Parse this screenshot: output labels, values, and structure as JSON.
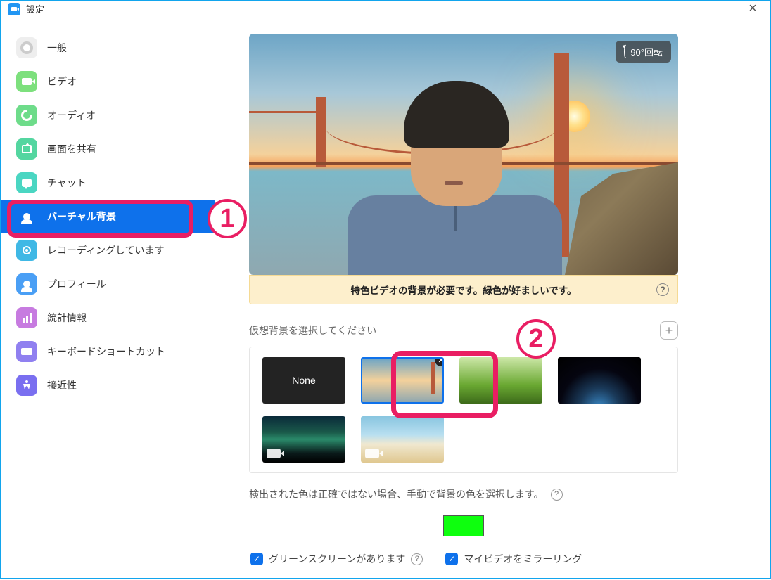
{
  "titlebar": {
    "title": "設定"
  },
  "sidebar": {
    "items": [
      {
        "label": "一般"
      },
      {
        "label": "ビデオ"
      },
      {
        "label": "オーディオ"
      },
      {
        "label": "画面を共有"
      },
      {
        "label": "チャット"
      },
      {
        "label": "バーチャル背景"
      },
      {
        "label": "レコーディングしています"
      },
      {
        "label": "プロフィール"
      },
      {
        "label": "統計情報"
      },
      {
        "label": "キーボードショートカット"
      },
      {
        "label": "接近性"
      }
    ],
    "selected_index": 5
  },
  "preview": {
    "rotate_label": "90°回転"
  },
  "notice": {
    "text": "特色ビデオの背景が必要です。緑色が好ましいです。"
  },
  "bg_select": {
    "label": "仮想背景を選択してください",
    "none_label": "None",
    "selected_index": 1
  },
  "detect": {
    "text": "検出された色は正確ではない場合、手動で背景の色を選択します。"
  },
  "color_swatch": "#0eff0e",
  "checks": {
    "green_screen": "グリーンスクリーンがあります",
    "mirror": "マイビデオをミラーリング"
  },
  "annotations": {
    "one": "1",
    "two": "2"
  }
}
